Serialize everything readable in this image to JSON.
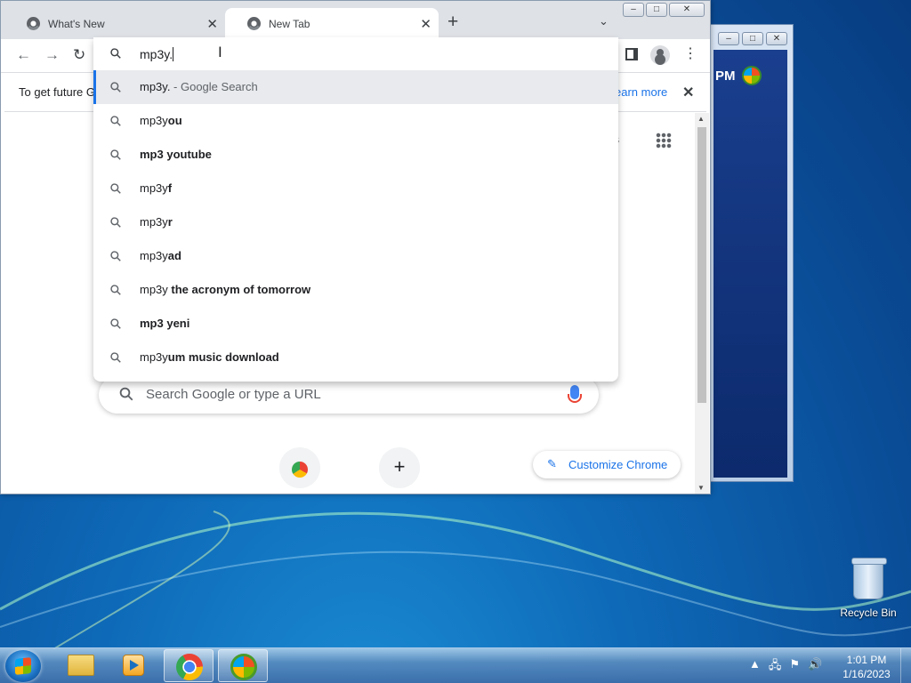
{
  "browser": {
    "tabs": [
      {
        "title": "What's New",
        "active": false
      },
      {
        "title": "New Tab",
        "active": true
      }
    ],
    "omnibox": {
      "value": "mp3y.",
      "suggestions": [
        {
          "prefix": "mp3y.",
          "bold": "",
          "suffix": " - Google Search",
          "selected": true
        },
        {
          "prefix": "mp3y",
          "bold": "ou",
          "suffix": "",
          "selected": false
        },
        {
          "prefix": "",
          "bold": "mp3 youtube",
          "suffix": "",
          "selected": false
        },
        {
          "prefix": "mp3y",
          "bold": "f",
          "suffix": "",
          "selected": false
        },
        {
          "prefix": "mp3y",
          "bold": "r",
          "suffix": "",
          "selected": false
        },
        {
          "prefix": "mp3y",
          "bold": "ad",
          "suffix": "",
          "selected": false
        },
        {
          "prefix": "mp3y",
          "bold": " the acronym of tomorrow",
          "suffix": "",
          "selected": false
        },
        {
          "prefix": "",
          "bold": "mp3 yeni",
          "suffix": "",
          "selected": false
        },
        {
          "prefix": "mp3y",
          "bold": "um music download",
          "suffix": "",
          "selected": false
        }
      ]
    },
    "infobar": {
      "text": "To get future G",
      "learn_more": "earn more"
    },
    "ntp": {
      "images_link": "ges",
      "search_placeholder": "Search Google or type a URL",
      "customize_label": "Customize Chrome"
    }
  },
  "back_window": {
    "time_fragment": "PM"
  },
  "desktop": {
    "recycle_bin_label": "Recycle Bin"
  },
  "taskbar": {
    "clock_time": "1:01 PM",
    "clock_date": "1/16/2023"
  },
  "colors": {
    "accent": "#1a73e8",
    "selected_row": "#e8eaed",
    "tabstrip": "#dee1e6"
  }
}
